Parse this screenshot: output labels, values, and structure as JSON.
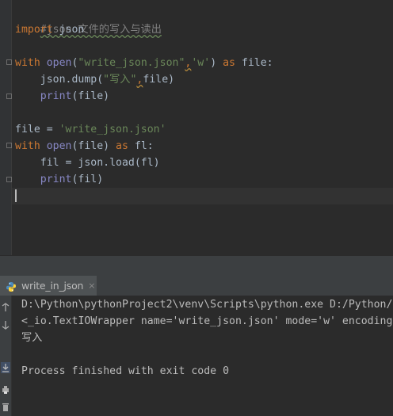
{
  "editor": {
    "lines": {
      "l1": {
        "comment": "#json 文件的写入与读出"
      },
      "l2": {
        "kw_import": "import",
        "rest": " json"
      },
      "l4": {
        "kw_with": "with",
        "fn_open": " open",
        "p1": "(",
        "s1": "\"write_json.json\"",
        "sep": ",",
        "s2": "'w'",
        "p2": ") ",
        "kw_as": "as",
        "rest": " file:"
      },
      "l5": {
        "pre": "    json.dump(",
        "s1": "\"写入\"",
        "sep": ",",
        "rest": "file)"
      },
      "l6": {
        "fn_print": "    print",
        "rest": "(file)"
      },
      "l8": {
        "pre": "file = ",
        "s1": "'write_json.json'"
      },
      "l9": {
        "kw_with": "with",
        "fn_open": " open",
        "rest": "(file) ",
        "kw_as": "as",
        "rest2": " fl:"
      },
      "l10": {
        "rest": "    fil = json.load(fl)"
      },
      "l11": {
        "fn_print": "    print",
        "rest": "(fil)"
      }
    }
  },
  "run": {
    "tab_label": "write_in_json",
    "tab_close": "×",
    "output": [
      "D:\\Python\\pythonProject2\\venv\\Scripts\\python.exe D:/Python/",
      "<_io.TextIOWrapper name='write_json.json' mode='w' encoding",
      "写入",
      "",
      "Process finished with exit code 0"
    ]
  },
  "colors": {
    "editor_bg": "#2b2b2b",
    "keyword": "#cc7832",
    "string": "#6a8759",
    "builtin": "#8888c6",
    "comment": "#808080",
    "text": "#a9b7c6"
  },
  "icons": {
    "run_tab": "python-icon",
    "toolbar": [
      "rerun-icon",
      "stop-icon",
      "scroll-to-end-icon",
      "print-icon",
      "delete-icon"
    ]
  }
}
